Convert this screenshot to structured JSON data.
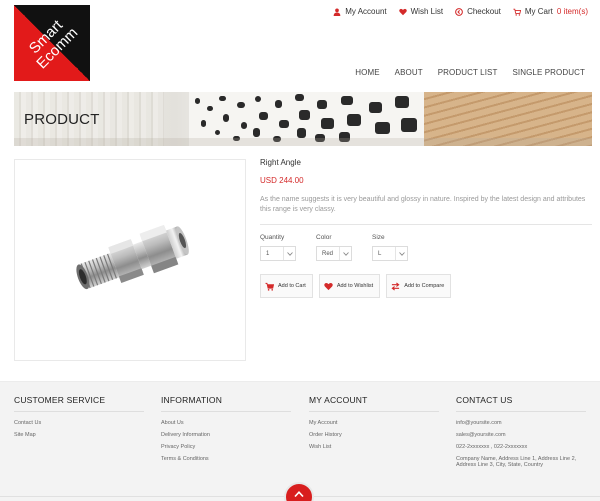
{
  "logo": {
    "line1": "Smart",
    "line2": "Ecomm"
  },
  "top_links": {
    "my_account": "My Account",
    "wish_list": "Wish List",
    "checkout": "Checkout",
    "my_cart": "My Cart",
    "cart_count": "0 item(s)"
  },
  "nav": [
    "HOME",
    "ABOUT",
    "PRODUCT LIST",
    "SINGLE PRODUCT"
  ],
  "banner": {
    "title": "PRODUCT"
  },
  "product": {
    "name": "Right Angle",
    "price": "USD 244.00",
    "description": "As the name suggests it is very beautiful and glossy in nature. Inspired by the latest design and attributes this range is very classy.",
    "options": {
      "quantity": {
        "label": "Quantity",
        "value": "1"
      },
      "color": {
        "label": "Color",
        "value": "Red"
      },
      "size": {
        "label": "Size",
        "value": "L"
      }
    },
    "actions": {
      "add_to_cart": "Add to Cart",
      "add_to_wishlist": "Add to Wishlist",
      "add_to_compare": "Add to Compare"
    }
  },
  "footer": {
    "customer_service": {
      "title": "CUSTOMER SERVICE",
      "links": [
        "Contact Us",
        "Site Map"
      ]
    },
    "information": {
      "title": "INFORMATION",
      "links": [
        "About Us",
        "Delivery Information",
        "Privacy Policy",
        "Terms & Conditions"
      ]
    },
    "my_account": {
      "title": "MY ACCOUNT",
      "links": [
        "My Account",
        "Order History",
        "Wish List"
      ]
    },
    "contact": {
      "title": "CONTACT US",
      "email_info": "info@yoursite.com",
      "email_sales": "sales@yoursite.com",
      "phones": "022-2xxxxxxx , 022-2xxxxxxx",
      "address": "Company Name, Address Line 1, Address Line 2, Address Line 3, City, State, Country"
    }
  },
  "colors": {
    "accent": "#d42a2a",
    "logo_dark": "#111111",
    "logo_red": "#e21a1a",
    "footer_bg": "#f3f3f3"
  },
  "icons": {
    "my_account": "user-icon",
    "wish_list": "heart-icon",
    "checkout": "checkout-arrow-icon",
    "cart": "cart-icon",
    "to_top": "chevron-up-icon"
  }
}
